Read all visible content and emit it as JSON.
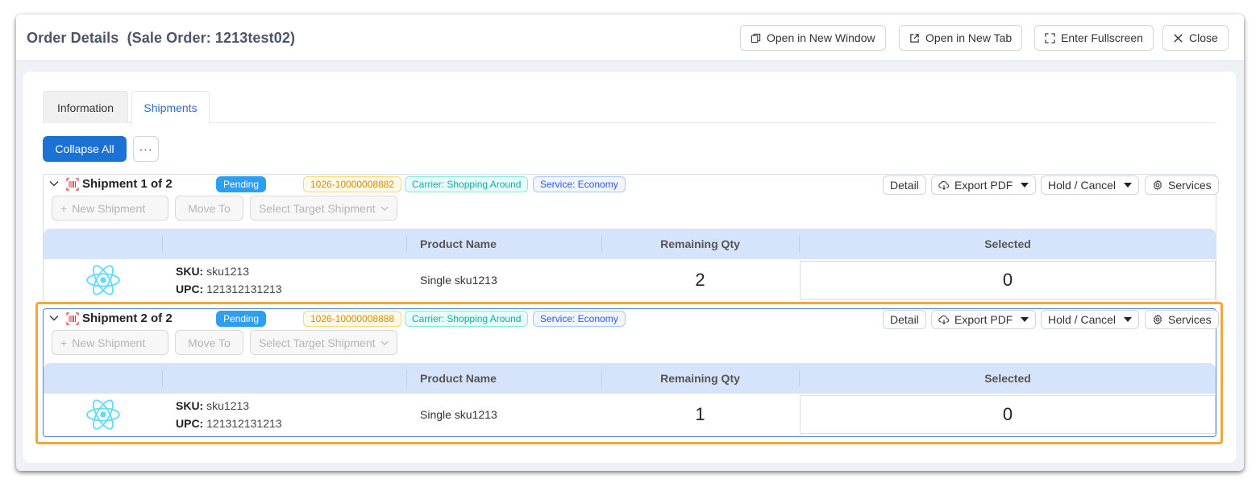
{
  "window": {
    "title": "Order Details",
    "subtitle": "(Sale Order: 1213test02)",
    "buttons": {
      "open_window": "Open in New Window",
      "open_tab": "Open in New Tab",
      "fullscreen": "Enter Fullscreen",
      "close": "Close"
    }
  },
  "tabs": [
    {
      "label": "Information",
      "active": false
    },
    {
      "label": "Shipments",
      "active": true
    }
  ],
  "toolbar": {
    "collapse_all": "Collapse All",
    "more": "···"
  },
  "shipment_actions": {
    "new_shipment": "New Shipment",
    "move_to": "Move To",
    "select_target": "Select Target Shipment",
    "detail": "Detail",
    "export_pdf": "Export PDF",
    "hold_cancel": "Hold / Cancel",
    "services": "Services"
  },
  "table_headers": {
    "product_name": "Product Name",
    "remaining_qty": "Remaining Qty",
    "selected": "Selected"
  },
  "shipments": [
    {
      "title": "Shipment 1 of 2",
      "status": "Pending",
      "order_no": "1026-10000008882",
      "carrier": "Carrier: Shopping Around",
      "service": "Service: Economy",
      "item": {
        "sku_label": "SKU:",
        "sku": "sku1213",
        "upc_label": "UPC:",
        "upc": "121312131213",
        "product_name": "Single sku1213",
        "remaining_qty": "2",
        "selected": "0"
      }
    },
    {
      "title": "Shipment 2 of 2",
      "status": "Pending",
      "order_no": "1026-10000008888",
      "carrier": "Carrier: Shopping Around",
      "service": "Service: Economy",
      "item": {
        "sku_label": "SKU:",
        "sku": "sku1213",
        "upc_label": "UPC:",
        "upc": "121312131213",
        "product_name": "Single sku1213",
        "remaining_qty": "1",
        "selected": "0"
      }
    }
  ],
  "colors": {
    "primary": "#1a73d4",
    "pending": "#2d9ef0",
    "highlight": "#f3a73a",
    "table_header": "#d6e4fb"
  }
}
